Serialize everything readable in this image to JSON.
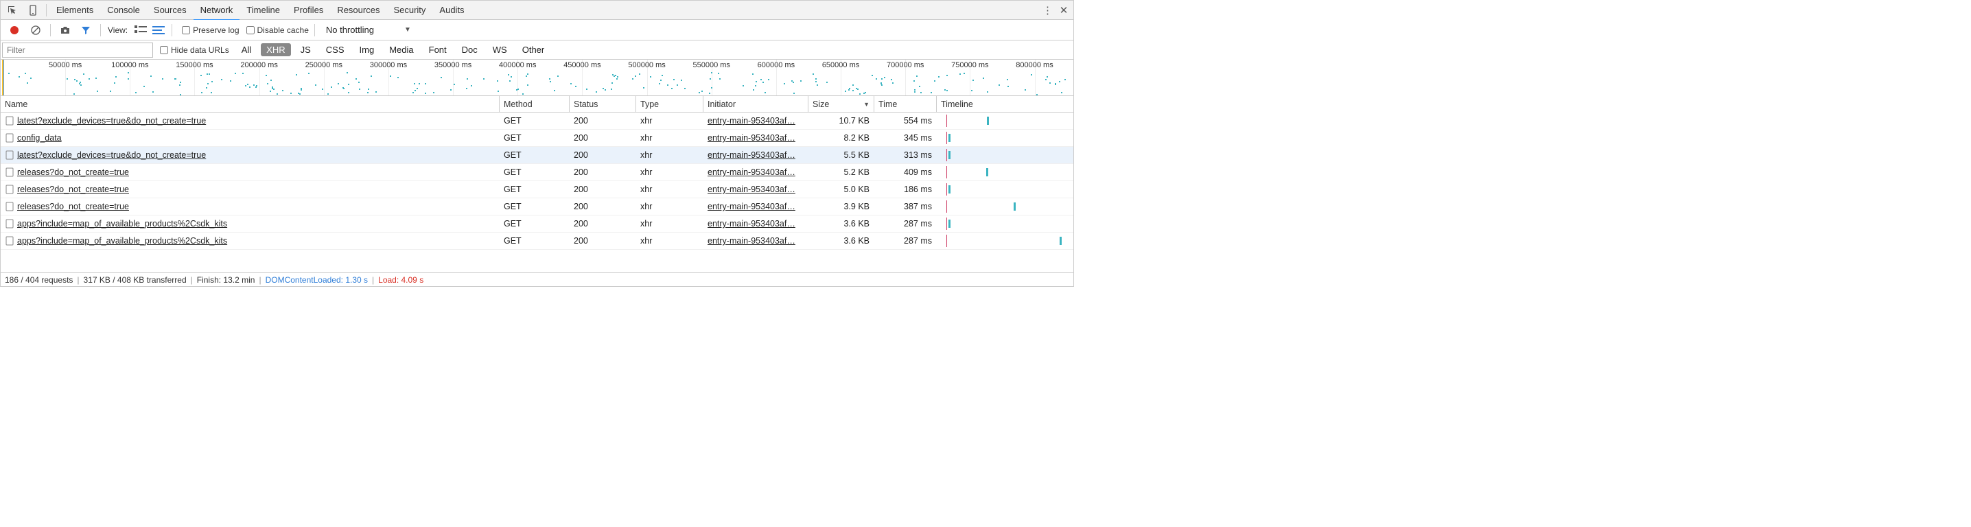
{
  "tabs": [
    "Elements",
    "Console",
    "Sources",
    "Network",
    "Timeline",
    "Profiles",
    "Resources",
    "Security",
    "Audits"
  ],
  "active_tab": 3,
  "toolbar2": {
    "view_label": "View:",
    "preserve_log": "Preserve log",
    "disable_cache": "Disable cache",
    "throttling": "No throttling"
  },
  "filterbar": {
    "placeholder": "Filter",
    "hide_label": "Hide data URLs",
    "pills": [
      "All",
      "XHR",
      "JS",
      "CSS",
      "Img",
      "Media",
      "Font",
      "Doc",
      "WS",
      "Other"
    ],
    "active_pill": 1
  },
  "timeline": {
    "ticks": [
      50000,
      100000,
      150000,
      200000,
      250000,
      300000,
      350000,
      400000,
      450000,
      500000,
      550000,
      600000,
      650000,
      700000,
      750000,
      800000
    ]
  },
  "columns": {
    "name": "Name",
    "method": "Method",
    "status": "Status",
    "type": "Type",
    "initiator": "Initiator",
    "size": "Size",
    "time": "Time",
    "timeline": "Timeline"
  },
  "rows": [
    {
      "name": "latest?exclude_devices=true&do_not_create=true",
      "method": "GET",
      "status": "200",
      "type": "xhr",
      "initiator": "entry-main-953403af…",
      "size": "10.7 KB",
      "time": "554 ms",
      "tl": 59
    },
    {
      "name": "config_data",
      "method": "GET",
      "status": "200",
      "type": "xhr",
      "initiator": "entry-main-953403af…",
      "size": "8.2 KB",
      "time": "345 ms",
      "tl": 3
    },
    {
      "name": "latest?exclude_devices=true&do_not_create=true",
      "method": "GET",
      "status": "200",
      "type": "xhr",
      "initiator": "entry-main-953403af…",
      "size": "5.5 KB",
      "time": "313 ms",
      "tl": 3,
      "sel": true
    },
    {
      "name": "releases?do_not_create=true",
      "method": "GET",
      "status": "200",
      "type": "xhr",
      "initiator": "entry-main-953403af…",
      "size": "5.2 KB",
      "time": "409 ms",
      "tl": 58
    },
    {
      "name": "releases?do_not_create=true",
      "method": "GET",
      "status": "200",
      "type": "xhr",
      "initiator": "entry-main-953403af…",
      "size": "5.0 KB",
      "time": "186 ms",
      "tl": 3
    },
    {
      "name": "releases?do_not_create=true",
      "method": "GET",
      "status": "200",
      "type": "xhr",
      "initiator": "entry-main-953403af…",
      "size": "3.9 KB",
      "time": "387 ms",
      "tl": 98
    },
    {
      "name": "apps?include=map_of_available_products%2Csdk_kits",
      "method": "GET",
      "status": "200",
      "type": "xhr",
      "initiator": "entry-main-953403af…",
      "size": "3.6 KB",
      "time": "287 ms",
      "tl": 3
    },
    {
      "name": "apps?include=map_of_available_products%2Csdk_kits",
      "method": "GET",
      "status": "200",
      "type": "xhr",
      "initiator": "entry-main-953403af…",
      "size": "3.6 KB",
      "time": "287 ms",
      "tl": 165
    }
  ],
  "footer": {
    "requests": "186 / 404 requests",
    "transferred": "317 KB / 408 KB transferred",
    "finish": "Finish: 13.2 min",
    "dom": "DOMContentLoaded: 1.30 s",
    "load": "Load: 4.09 s"
  }
}
